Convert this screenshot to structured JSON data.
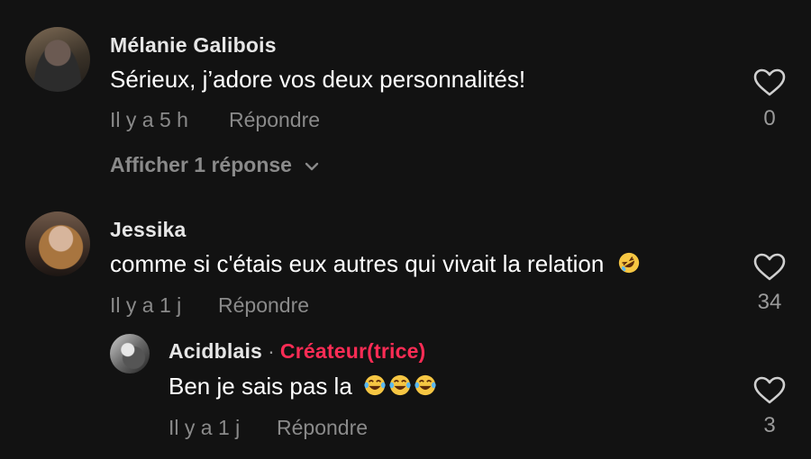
{
  "comments": [
    {
      "username": "Mélanie Galibois",
      "text": "Sérieux, j’adore vos deux personnalités!",
      "timestamp": "Il y a 5 h",
      "reply_label": "Répondre",
      "likes": "0",
      "show_replies": "Afficher 1 réponse"
    },
    {
      "username": "Jessika",
      "text": "comme si c'étais eux autres qui vivait la relation",
      "timestamp": "Il y a 1 j",
      "reply_label": "Répondre",
      "likes": "34",
      "emoji": "rolling-on-floor-laughing"
    },
    {
      "username": "Acidblais",
      "separator": "·",
      "badge": "Créateur(trice)",
      "text": "Ben je sais pas la",
      "timestamp": "Il y a 1 j",
      "reply_label": "Répondre",
      "likes": "3",
      "emoji": "face-with-tears-of-joy x3"
    }
  ],
  "colors": {
    "background": "#121212",
    "creator_badge": "#fe2c55",
    "secondary_text": "#8a8a8a"
  }
}
